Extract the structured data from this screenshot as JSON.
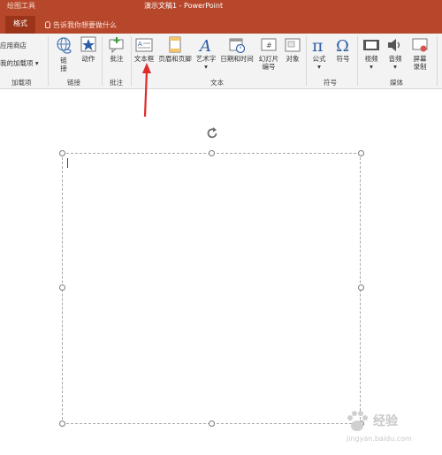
{
  "titlebar": {
    "context_label": "绘图工具",
    "title": "演示文稿1  -  PowerPoint"
  },
  "tabs": {
    "active": "格式",
    "tell_me": "告诉我你想要做什么"
  },
  "ribbon": {
    "addins": {
      "store": "应用商店",
      "my_addins": "我的加载项",
      "group": "加载项"
    },
    "links": {
      "link_1": "链",
      "link_2": "接",
      "action": "动作",
      "group": "链接"
    },
    "comments": {
      "comment": "批注",
      "group": "批注"
    },
    "text": {
      "textbox": "文本框",
      "header_footer": "页眉和页脚",
      "wordart": "艺术字",
      "datetime": "日期和时间",
      "slide_no_1": "幻灯片",
      "slide_no_2": "编号",
      "object": "对象",
      "group": "文本"
    },
    "symbols": {
      "equation": "公式",
      "symbol": "符号",
      "group": "符号"
    },
    "media": {
      "video": "视频",
      "audio": "音频",
      "screen_1": "屏幕",
      "screen_2": "录制",
      "group": "媒体"
    }
  },
  "watermark": {
    "brand": "经验",
    "url": "jingyan.baidu.com"
  },
  "colors": {
    "accent": "#b7472a",
    "annotation_arrow": "#e02b2b"
  }
}
